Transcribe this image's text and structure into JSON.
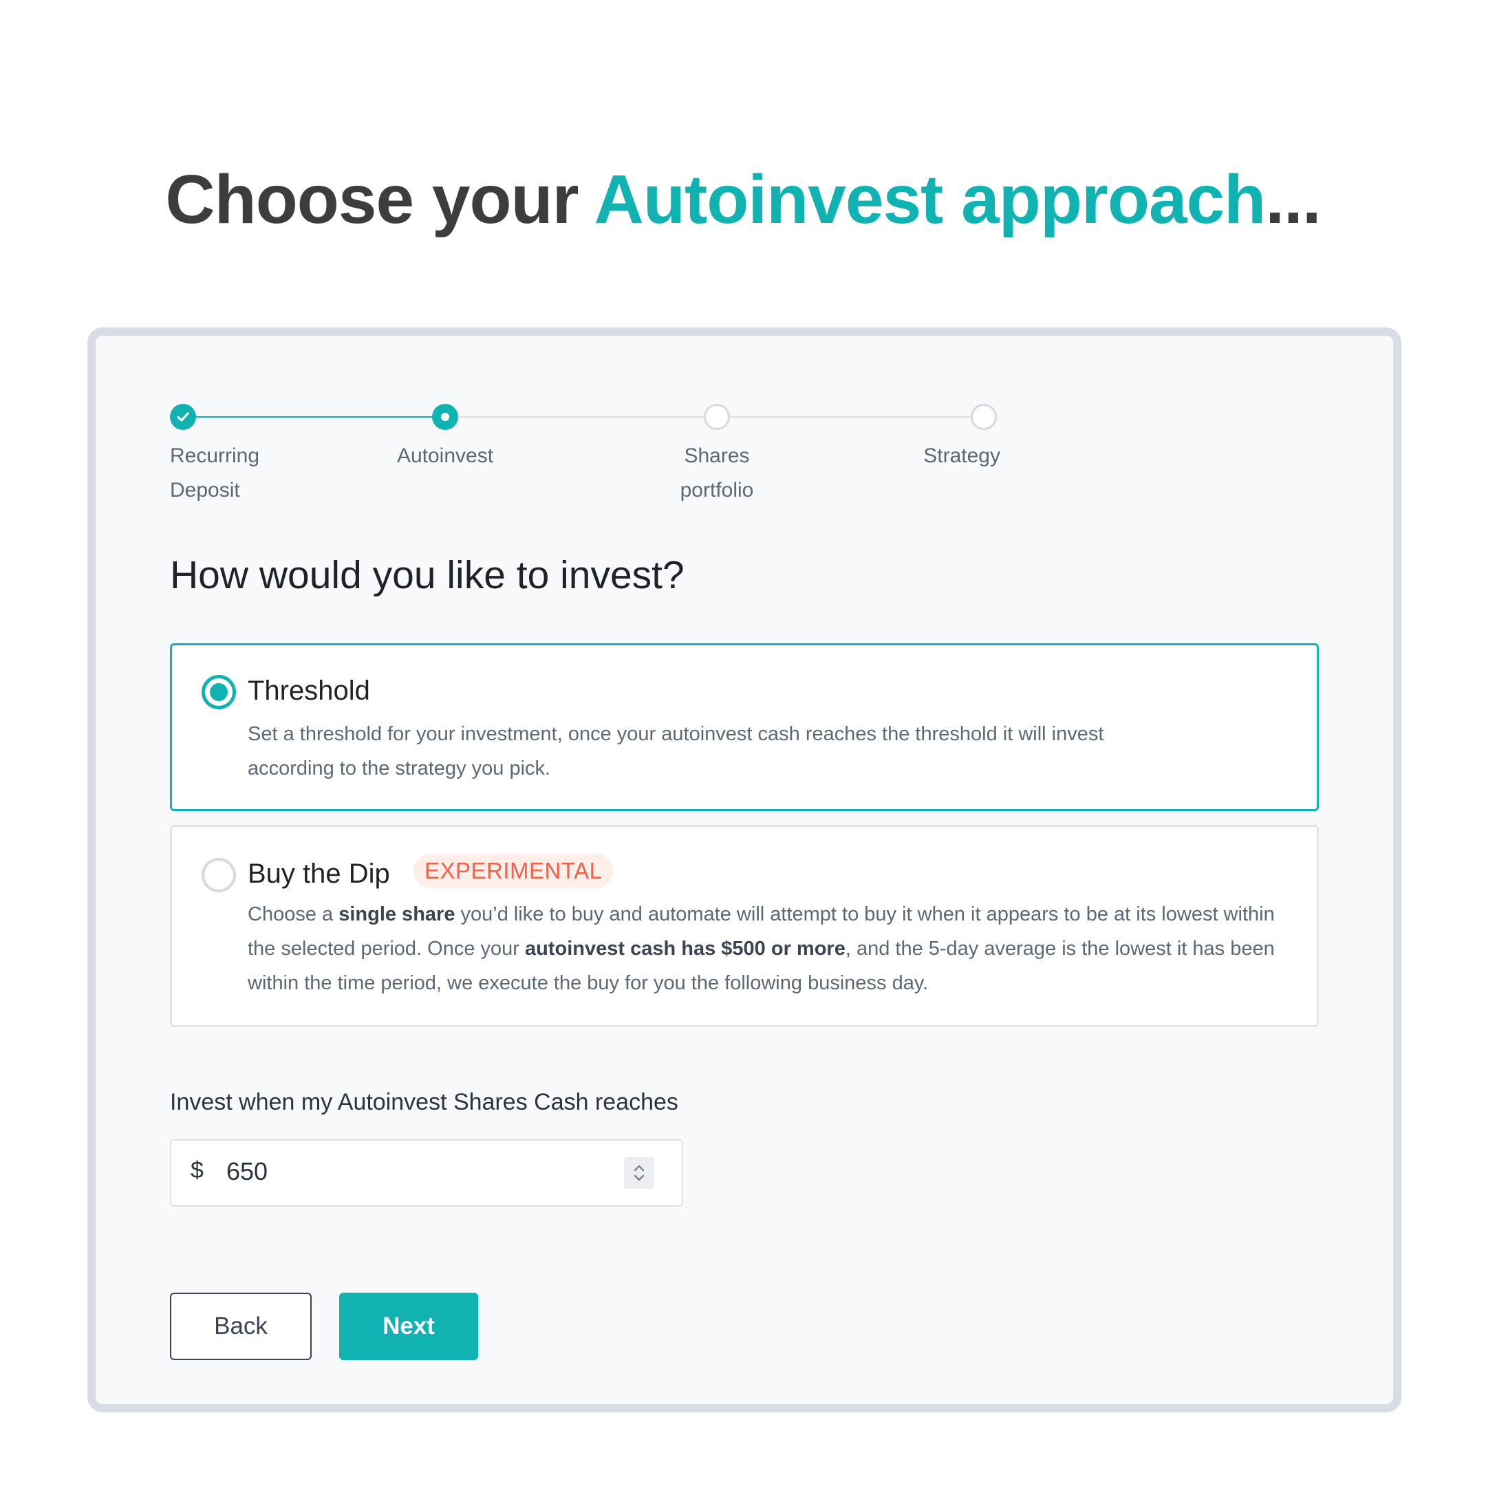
{
  "hero": {
    "prefix": "Choose your ",
    "accent": "Autoinvest approach",
    "suffix": "..."
  },
  "stepper": {
    "steps": [
      {
        "label_line1": "Recurring",
        "label_line2": "Deposit",
        "state": "completed"
      },
      {
        "label_line1": "Autoinvest",
        "label_line2": "",
        "state": "current"
      },
      {
        "label_line1": "Shares",
        "label_line2": "portfolio",
        "state": "upcoming"
      },
      {
        "label_line1": "Strategy",
        "label_line2": "",
        "state": "upcoming"
      }
    ]
  },
  "question": "How would you like to invest?",
  "options": [
    {
      "title": "Threshold",
      "selected": true,
      "description_line1": "Set a threshold for your investment, once your autoinvest cash reaches the threshold it will invest",
      "description_line2": "according to the strategy you pick."
    },
    {
      "title": "Buy the Dip",
      "selected": false,
      "badge": "EXPERIMENTAL",
      "desc_a": "Choose a ",
      "desc_b_bold": "single share",
      "desc_c": " you’d like to buy and automate will attempt to buy it when it appears to be at its lowest within the selected period. Once your ",
      "desc_d_bold": "autoinvest cash has $500 or more",
      "desc_e": ", and the 5-day average is the lowest it has been within the time period, we execute the buy for you the following business day."
    }
  ],
  "threshold_field": {
    "label": "Invest when my Autoinvest Shares Cash reaches",
    "currency_symbol": "$",
    "value": "650"
  },
  "buttons": {
    "back": "Back",
    "next": "Next"
  },
  "colors": {
    "accent": "#10b2b2",
    "badge_text": "#f0614a",
    "badge_bg": "#fdeeea",
    "heading": "#3d3d3d"
  }
}
